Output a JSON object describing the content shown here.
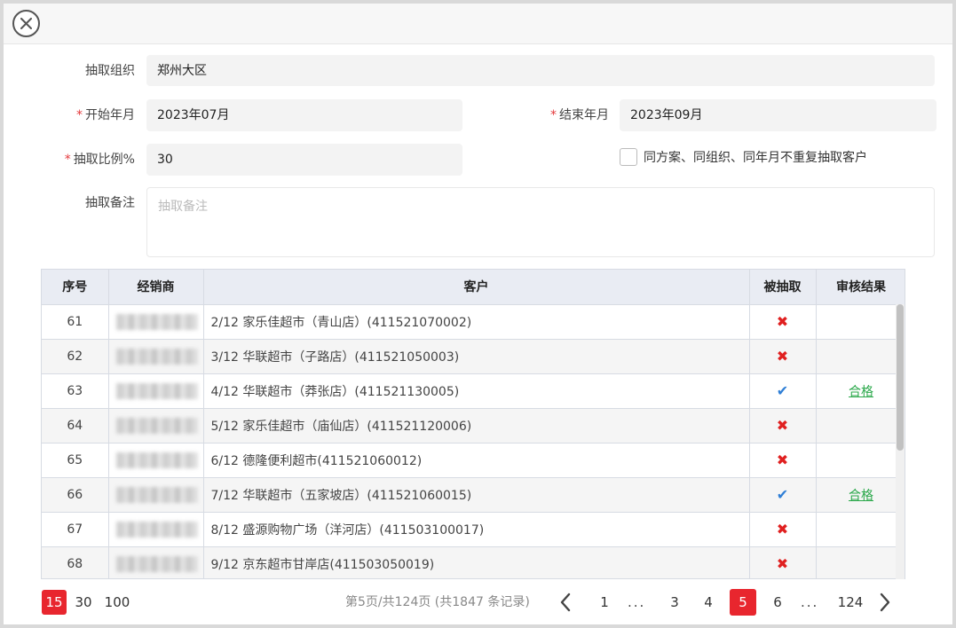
{
  "header": {
    "close_icon": "close-icon"
  },
  "form": {
    "org_label": "抽取组织",
    "org_value": "郑州大区",
    "start_label": "开始年月",
    "start_value": "2023年07月",
    "end_label": "结束年月",
    "end_value": "2023年09月",
    "ratio_label": "抽取比例%",
    "ratio_value": "30",
    "no_repeat_label": "同方案、同组织、同年月不重复抽取客户",
    "no_repeat_checked": false,
    "remark_label": "抽取备注",
    "remark_placeholder": "抽取备注",
    "required_mark": "*"
  },
  "table": {
    "headers": [
      "序号",
      "经销商",
      "客户",
      "被抽取",
      "审核结果"
    ],
    "rows": [
      {
        "no": "61",
        "customer": "2/12 家乐佳超市（青山店）(411521070002)",
        "selected": "x",
        "result": ""
      },
      {
        "no": "62",
        "customer": "3/12 华联超市（子路店）(411521050003)",
        "selected": "x",
        "result": ""
      },
      {
        "no": "63",
        "customer": "4/12 华联超市（莽张店）(411521130005)",
        "selected": "check",
        "result": "合格"
      },
      {
        "no": "64",
        "customer": "5/12 家乐佳超市（庙仙店）(411521120006)",
        "selected": "x",
        "result": ""
      },
      {
        "no": "65",
        "customer": "6/12 德隆便利超市(411521060012)",
        "selected": "x",
        "result": ""
      },
      {
        "no": "66",
        "customer": "7/12 华联超市（五家坡店）(411521060015)",
        "selected": "check",
        "result": "合格"
      },
      {
        "no": "67",
        "customer": "8/12 盛源购物广场（洋河店）(411503100017)",
        "selected": "x",
        "result": ""
      },
      {
        "no": "68",
        "customer": "9/12 京东超市甘岸店(411503050019)",
        "selected": "x",
        "result": ""
      }
    ],
    "marks": {
      "x": "✖",
      "check": "✔"
    }
  },
  "pagination": {
    "sizes": [
      "15",
      "30",
      "100"
    ],
    "active_size": "15",
    "info": "第5页/共124页 (共1847 条记录)",
    "pages": [
      "1",
      "...",
      "3",
      "4",
      "5",
      "6",
      "...",
      "124"
    ],
    "current_page": "5",
    "prev_icon": "chevron-left-icon",
    "next_icon": "chevron-right-icon"
  },
  "colors": {
    "accent": "#e8262e",
    "pass": "#2aa84a",
    "reject": "#e02020",
    "check": "#2f7fd6"
  }
}
